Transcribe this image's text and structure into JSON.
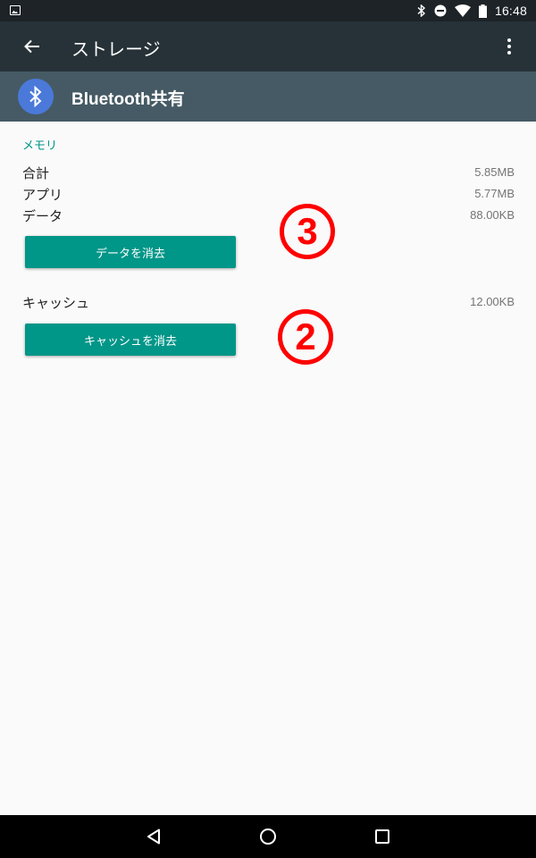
{
  "status_bar": {
    "time": "16:48",
    "icons": [
      "image-icon",
      "bluetooth-icon",
      "do-not-disturb-icon",
      "wifi-icon",
      "battery-icon"
    ]
  },
  "app_bar": {
    "title": "ストレージ",
    "icons": [
      "back-arrow-icon",
      "more-vert-icon"
    ]
  },
  "app_info": {
    "name": "Bluetooth共有",
    "icon": "bluetooth-icon",
    "icon_color": "#4a79d9"
  },
  "memory": {
    "header": "メモリ",
    "rows": [
      {
        "label": "合計",
        "value": "5.85MB"
      },
      {
        "label": "アプリ",
        "value": "5.77MB"
      },
      {
        "label": "データ",
        "value": "88.00KB"
      }
    ],
    "clear_data_label": "データを消去"
  },
  "cache": {
    "label": "キャッシュ",
    "value": "12.00KB",
    "clear_cache_label": "キャッシュを消去"
  },
  "annotations": [
    {
      "number": "3"
    },
    {
      "number": "2"
    }
  ],
  "nav_bar": {
    "icons": [
      "back-triangle-icon",
      "home-circle-icon",
      "recents-square-icon"
    ]
  },
  "colors": {
    "accent": "#009688",
    "toolbar": "#263238",
    "app_header": "#455a64",
    "annotation": "#ff0000"
  }
}
